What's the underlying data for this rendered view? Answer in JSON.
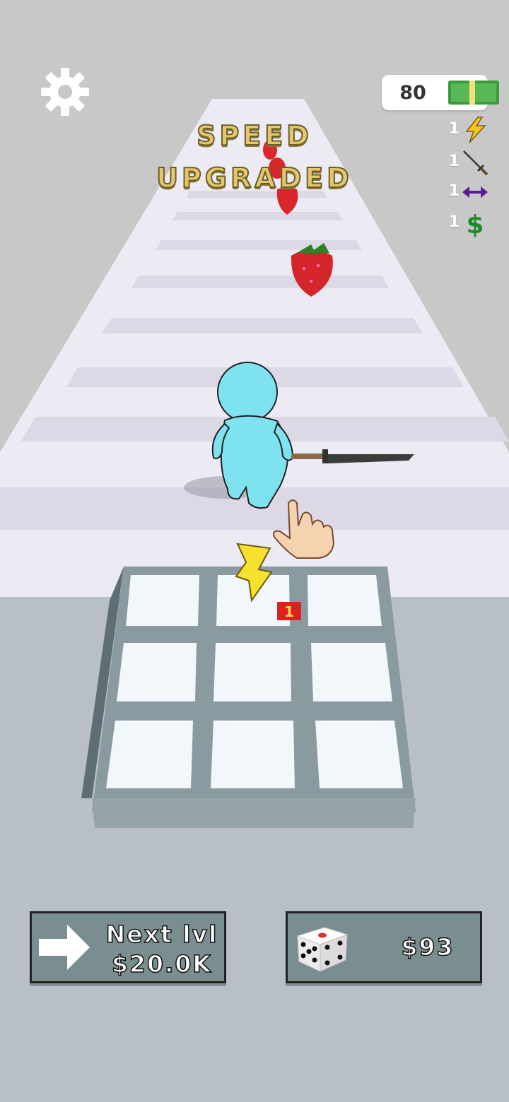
{
  "hud": {
    "money": "80",
    "stats": [
      {
        "count": "1",
        "icon": "lightning-bolt-icon"
      },
      {
        "count": "1",
        "icon": "sword-icon"
      },
      {
        "count": "1",
        "icon": "double-arrow-icon"
      },
      {
        "count": "1",
        "icon": "dollar-sign-icon"
      }
    ]
  },
  "banner": {
    "line1": "SPEED",
    "line2": "UPGRADED"
  },
  "grid": {
    "slot_badge": "1"
  },
  "buttons": {
    "next_level_line1": "Next lvl",
    "next_level_line2": "$20.0K",
    "dice_price": "$93"
  },
  "colors": {
    "background": "#b8bfc7",
    "track": "#eceaf3",
    "character": "#7ee3ee",
    "button": "#7a8e91",
    "banner_text": "#e3c76a"
  }
}
